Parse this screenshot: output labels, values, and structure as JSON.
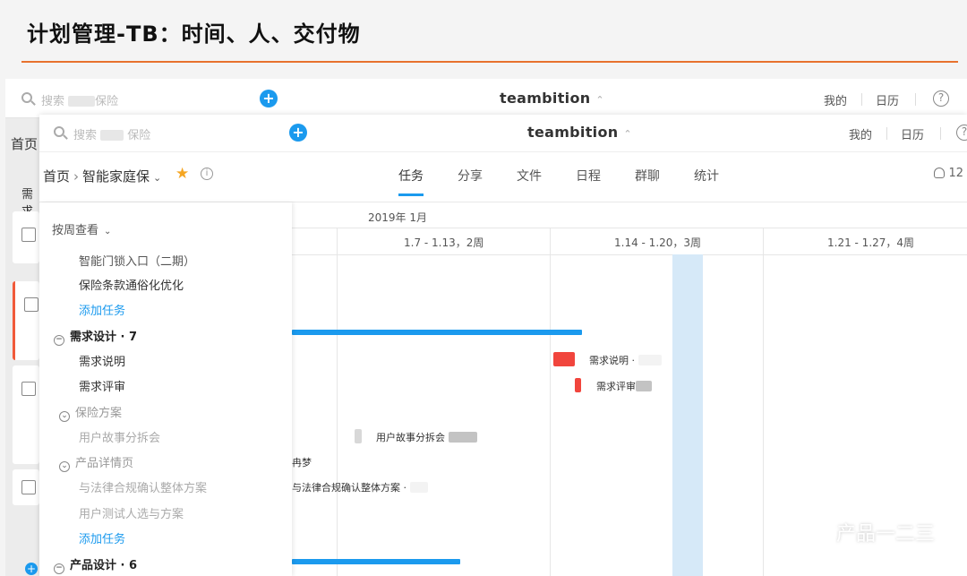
{
  "slide": {
    "title": "计划管理-TB：时间、人、交付物",
    "accent": "#e8722e"
  },
  "back_app": {
    "search_placeholder": "搜索",
    "search_suffix": "保险",
    "brand": "teambition",
    "nav": [
      "我的",
      "日历"
    ],
    "help": "?",
    "home": "首页",
    "group_partial": "需求"
  },
  "front_app": {
    "search_placeholder": "搜索",
    "search_suffix": "保险",
    "brand": "teambition",
    "nav": [
      "我的",
      "日历"
    ],
    "help": "?",
    "breadcrumb": {
      "home": "首页",
      "project": "智能家庭保"
    },
    "tabs": [
      "任务",
      "分享",
      "文件",
      "日程",
      "群聊",
      "统计"
    ],
    "active_tab": "任务",
    "member_count": "12",
    "accent": "#1b9aee"
  },
  "task_list": {
    "view_toggle": "按周查看",
    "rows": [
      {
        "text": "智能门锁入口（二期）",
        "style": "normal"
      },
      {
        "text": "保险条款通俗化优化",
        "style": "normal"
      },
      {
        "text": "添加任务",
        "style": "link"
      },
      {
        "text": "需求设计 · 7",
        "style": "group"
      },
      {
        "text": "需求说明",
        "style": "normal"
      },
      {
        "text": "需求评审",
        "style": "normal"
      },
      {
        "text": "保险方案",
        "style": "subgroup"
      },
      {
        "text": "用户故事分拆会",
        "style": "dim"
      },
      {
        "text": "产品详情页",
        "style": "subgroup"
      },
      {
        "text": "与法律合规确认整体方案",
        "style": "dim"
      },
      {
        "text": "用户测试人选与方案",
        "style": "dim"
      },
      {
        "text": "添加任务",
        "style": "link"
      },
      {
        "text": "产品设计 · 6",
        "style": "group"
      }
    ]
  },
  "gantt": {
    "month": "2019年 1月",
    "weeks": [
      "1.7 - 1.13，2周",
      "1.14 - 1.20，3周",
      "1.21 - 1.27，4周"
    ],
    "bar_labels": {
      "spec": "需求说明 ·",
      "review": "需求评审",
      "story": "用户故事分拆会",
      "assignee": "冉梦",
      "legal": "与法律合规确认整体方案 ·"
    },
    "colors": {
      "group_bar": "#1b9aee",
      "red": "#f1453d",
      "today": "#d6e9f8"
    }
  },
  "watermark": "产品一二三"
}
